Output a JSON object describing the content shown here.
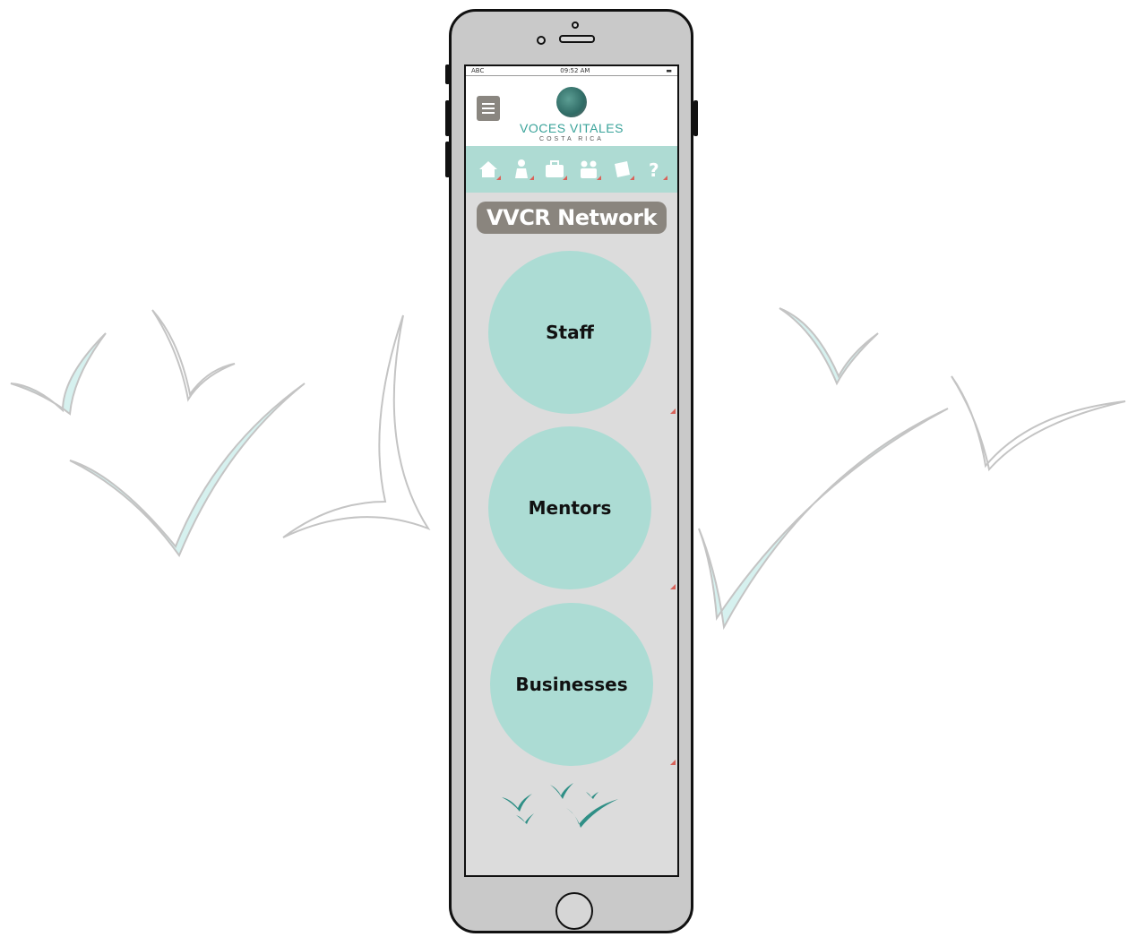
{
  "statusbar": {
    "carrier": "ABC",
    "time": "09:52 AM"
  },
  "header": {
    "menu_icon": "hamburger-icon",
    "logo_title": "VOCES VITALES",
    "logo_subtitle": "COSTA RICA"
  },
  "nav": {
    "icons": [
      "home-icon",
      "person-icon",
      "briefcase-icon",
      "group-icon",
      "document-icon",
      "help-icon"
    ]
  },
  "page": {
    "title": "VVCR Network"
  },
  "buttons": [
    {
      "label": "Staff"
    },
    {
      "label": "Mentors"
    },
    {
      "label": "Businesses"
    }
  ],
  "colors": {
    "accent": "#aedbd3",
    "title_bg": "#8a857e",
    "screen_bg": "#dcdcdc",
    "arrow": "#d9635a",
    "brand_text": "#3aa39a"
  }
}
